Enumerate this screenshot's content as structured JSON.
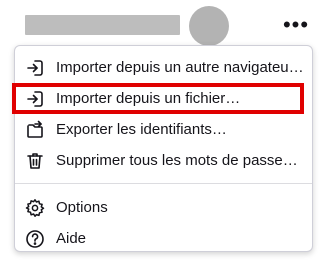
{
  "header": {
    "more_icon": "more-horizontal-icon",
    "more_glyph": "•••"
  },
  "menu": {
    "items": [
      {
        "label": "Importer depuis un autre navigateur…",
        "icon": "import-icon"
      },
      {
        "label": "Importer depuis un fichier…",
        "icon": "import-icon",
        "highlighted": true
      },
      {
        "label": "Exporter les identifiants…",
        "icon": "export-folder-icon"
      },
      {
        "label": "Supprimer tous les mots de passe…",
        "icon": "trash-icon"
      },
      {
        "label": "Options",
        "icon": "gear-icon"
      },
      {
        "label": "Aide",
        "icon": "help-icon"
      }
    ],
    "highlight_color": "#e00000"
  }
}
